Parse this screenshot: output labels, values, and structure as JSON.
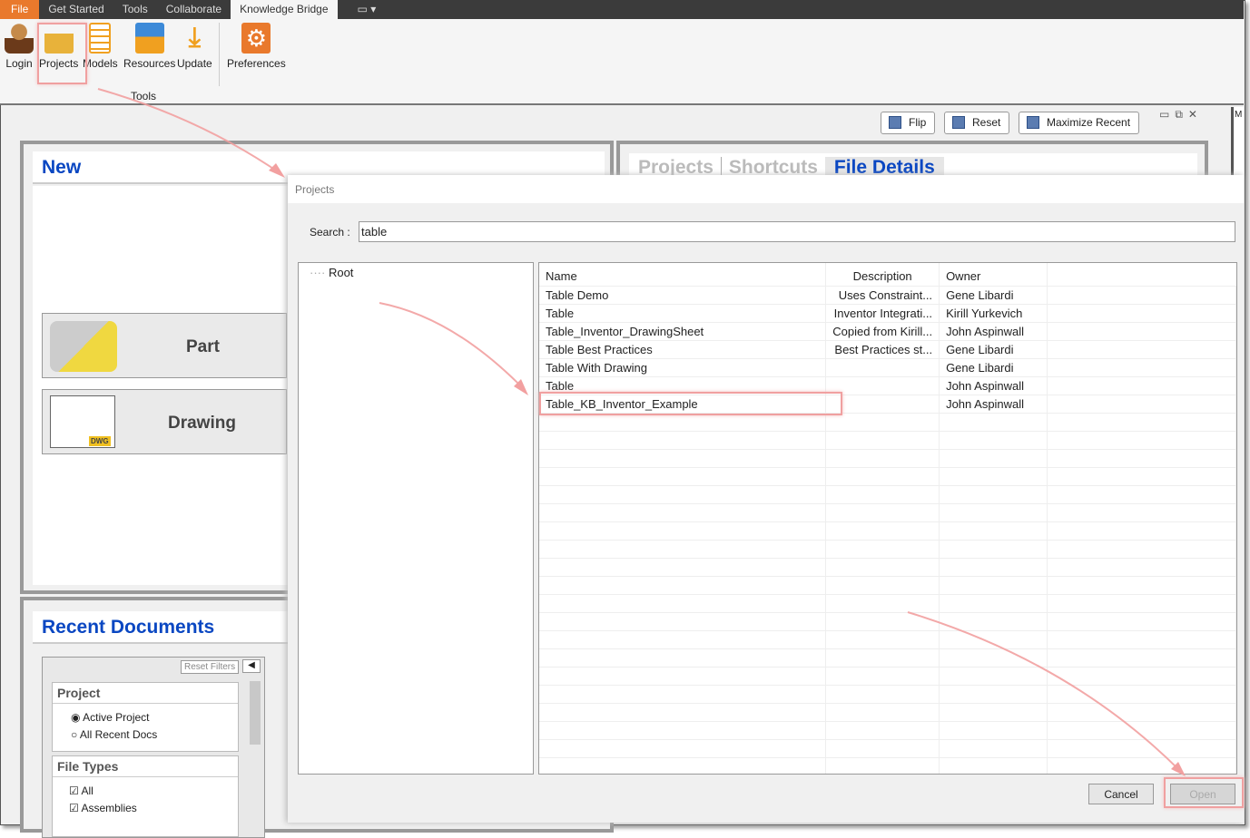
{
  "ribbon": {
    "tabs": [
      "File",
      "Get Started",
      "Tools",
      "Collaborate",
      "Knowledge Bridge"
    ],
    "buttons": [
      {
        "label": "Login",
        "icon": "login-user-key-icon"
      },
      {
        "label": "Projects",
        "icon": "folder-open-icon"
      },
      {
        "label": "Models",
        "icon": "list-icon"
      },
      {
        "label": "Resources",
        "icon": "folder-documents-icon"
      },
      {
        "label": "Update",
        "icon": "download-icon"
      },
      {
        "label": "Preferences",
        "icon": "gear-icon"
      }
    ],
    "group_label": "Tools"
  },
  "toolbar": {
    "flip": "Flip",
    "reset": "Reset",
    "maximize_recent": "Maximize Recent",
    "side_letter": "M"
  },
  "new_panel": {
    "title": "New",
    "part": "Part",
    "drawing": "Drawing",
    "dwg_badge": "DWG"
  },
  "right_panel": {
    "tabs": [
      "Projects",
      "Shortcuts",
      "File Details"
    ],
    "active_tab": "File Details"
  },
  "recent": {
    "title": "Recent Documents",
    "reset_filters": "Reset Filters",
    "project_group": {
      "title": "Project",
      "options": [
        {
          "label": "Active Project",
          "selected": true
        },
        {
          "label": "All Recent Docs",
          "selected": false
        }
      ]
    },
    "file_types": {
      "title": "File Types",
      "options": [
        {
          "label": "All",
          "checked": true
        },
        {
          "label": "Assemblies",
          "checked": true
        }
      ]
    }
  },
  "dialog": {
    "title": "Projects",
    "search_label": "Search :",
    "search_value": "table",
    "tree_root": "Root",
    "columns": [
      "Name",
      "Description",
      "Owner"
    ],
    "rows": [
      [
        "Table Demo",
        "Uses Constraint...",
        "Gene Libardi"
      ],
      [
        "Table",
        "Inventor Integrati...",
        "Kirill Yurkevich"
      ],
      [
        "Table_Inventor_DrawingSheet",
        "Copied from Kirill...",
        "John Aspinwall"
      ],
      [
        "Table Best Practices",
        "Best Practices st...",
        "Gene Libardi"
      ],
      [
        "Table With Drawing",
        "",
        "Gene Libardi"
      ],
      [
        "Table",
        "",
        "John Aspinwall"
      ],
      [
        "Table_KB_Inventor_Example",
        "",
        "John Aspinwall"
      ]
    ],
    "cancel": "Cancel",
    "open": "Open"
  },
  "colors": {
    "accent": "#0a47c2",
    "file_tab": "#e9792c",
    "highlight": "#f0a0a0"
  }
}
